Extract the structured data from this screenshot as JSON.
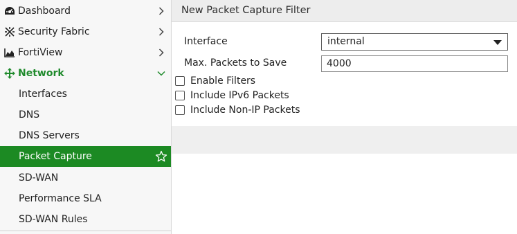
{
  "sidebar": {
    "items": [
      {
        "label": "Dashboard",
        "icon": "dashboard-icon",
        "expandable": true
      },
      {
        "label": "Security Fabric",
        "icon": "security-fabric-icon",
        "expandable": true
      },
      {
        "label": "FortiView",
        "icon": "fortiview-icon",
        "expandable": true
      },
      {
        "label": "Network",
        "icon": "network-icon",
        "expanded": true
      },
      {
        "label": "Interfaces"
      },
      {
        "label": "DNS"
      },
      {
        "label": "DNS Servers"
      },
      {
        "label": "Packet Capture",
        "active": true,
        "favorite_icon": "star-icon"
      },
      {
        "label": "SD-WAN"
      },
      {
        "label": "Performance SLA"
      },
      {
        "label": "SD-WAN Rules"
      }
    ]
  },
  "panel": {
    "title": "New Packet Capture Filter",
    "interface_label": "Interface",
    "interface_value": "internal",
    "max_packets_label": "Max. Packets to Save",
    "max_packets_value": "4000",
    "checkboxes": [
      {
        "label": "Enable Filters",
        "checked": false
      },
      {
        "label": "Include IPv6 Packets",
        "checked": false
      },
      {
        "label": "Include Non-IP Packets",
        "checked": false
      }
    ]
  },
  "colors": {
    "accent_green": "#1c8a23",
    "network_text": "#1f8a2c"
  }
}
